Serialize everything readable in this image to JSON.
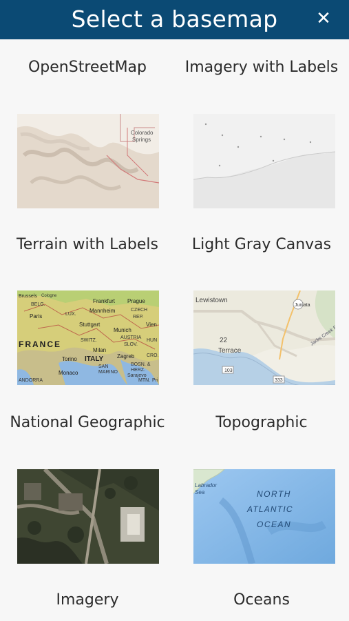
{
  "header": {
    "title": "Select a basemap",
    "close_glyph": "✕",
    "background": "#0b4a74"
  },
  "basemaps": [
    {
      "label": "OpenStreetMap",
      "labels": [
        "Colorado",
        "Springs"
      ]
    },
    {
      "label": "Imagery with Labels",
      "labels": []
    },
    {
      "label": "Terrain with Labels",
      "labels": [
        "Brussels",
        "Cologne",
        "BELG.",
        "Frankfurt",
        "Prague",
        "Paris",
        "LUX.",
        "Mannheim",
        "CZECH",
        "REP.",
        "Stuttgart",
        "Vien",
        "Munich",
        "FRANCE",
        "SWITZ.",
        "AUSTRIA",
        "SLOV.",
        "HUN",
        "Milan",
        "Torino",
        "ITALY",
        "Zagreb",
        "BOSN. &",
        "HERZ.",
        "CRO.",
        "Monaco",
        "SAN",
        "MARINO",
        "Sarajevo",
        "ANDORRA",
        "MTN.",
        "Pri"
      ]
    },
    {
      "label": "Light Gray Canvas",
      "labels": [
        "Lewistown",
        "22",
        "Juniata",
        "Terrace",
        "Jacks Creek R",
        "103",
        "333"
      ]
    },
    {
      "label": "National Geographic",
      "labels": []
    },
    {
      "label": "Topographic",
      "labels": [
        "Labrador",
        "Sea",
        "NORTH",
        "ATLANTIC",
        "OCEAN"
      ]
    },
    {
      "label": "Imagery",
      "labels": []
    },
    {
      "label": "Oceans",
      "labels": []
    }
  ]
}
